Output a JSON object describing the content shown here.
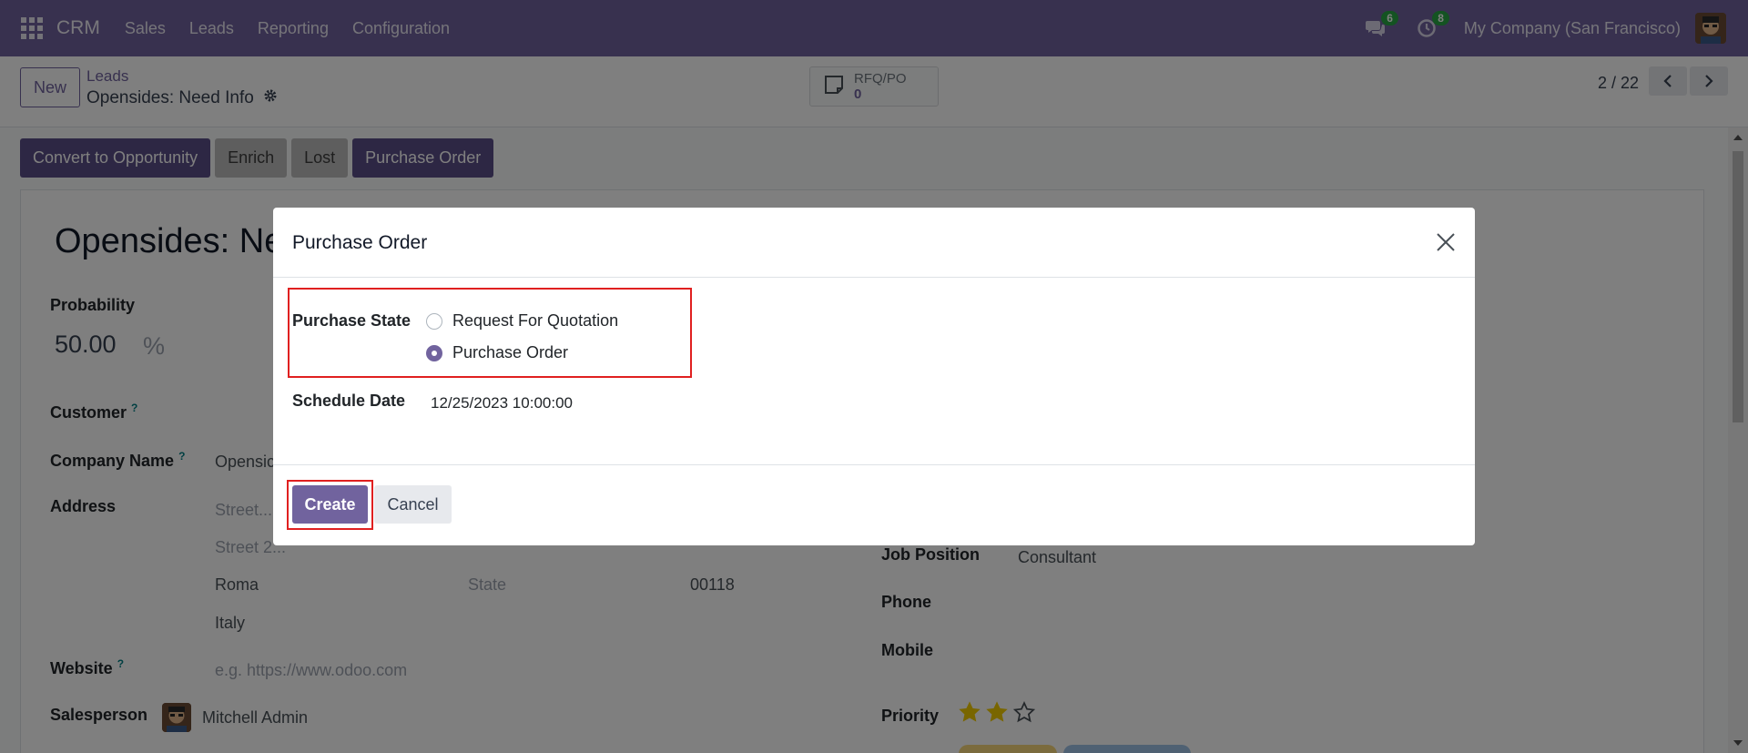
{
  "navbar": {
    "brand": "CRM",
    "menu": [
      "Sales",
      "Leads",
      "Reporting",
      "Configuration"
    ],
    "messages_badge": "6",
    "activities_badge": "8",
    "company": "My Company (San Francisco)"
  },
  "control_panel": {
    "new_label": "New",
    "breadcrumb_parent": "Leads",
    "breadcrumb_current": "Opensides: Need Info",
    "smart_button": {
      "label": "RFQ/PO",
      "count": "0"
    },
    "pager": "2 / 22"
  },
  "status_buttons": [
    "Convert to Opportunity",
    "Enrich",
    "Lost",
    "Purchase Order"
  ],
  "form": {
    "title": "Opensides: Ne",
    "probability_label": "Probability",
    "probability_value": "50.00",
    "probability_unit": "%",
    "customer_label": "Customer",
    "company_name_label": "Company Name",
    "company_name_value": "Opensic",
    "address_label": "Address",
    "street_placeholder": "Street...",
    "street2_placeholder": "Street 2...",
    "city": "Roma",
    "state_placeholder": "State",
    "zip": "00118",
    "country": "Italy",
    "website_label": "Website",
    "website_placeholder": "e.g. https://www.odoo.com",
    "salesperson_label": "Salesperson",
    "salesperson_value": "Mitchell Admin",
    "job_position_label": "Job Position",
    "job_position_value": "Consultant",
    "phone_label": "Phone",
    "mobile_label": "Mobile",
    "priority_label": "Priority",
    "priority_stars": 2,
    "priority_max": 3,
    "help_mark": "?"
  },
  "modal": {
    "title": "Purchase Order",
    "purchase_state_label": "Purchase State",
    "options": [
      "Request For Quotation",
      "Purchase Order"
    ],
    "selected_option": "Purchase Order",
    "schedule_date_label": "Schedule Date",
    "schedule_date_value": "12/25/2023 10:00:00",
    "create_label": "Create",
    "cancel_label": "Cancel"
  },
  "colors": {
    "brand": "#71639e",
    "highlight": "#e02020",
    "star": "#f3cc00"
  }
}
